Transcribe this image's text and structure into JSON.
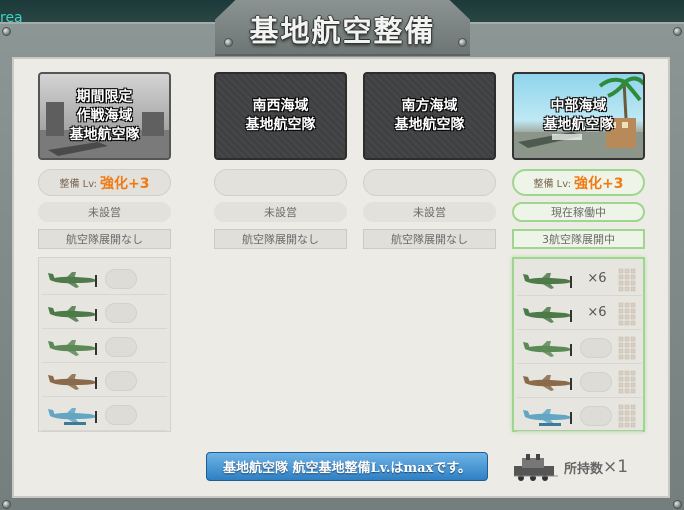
{
  "window": {
    "title": "基地航空整備",
    "corner_text": "rea"
  },
  "columns": [
    {
      "card_label": [
        "期間限定",
        "作戦海域",
        "基地航空隊"
      ],
      "card_style": "event",
      "level_label": "整備 Lv:",
      "level_value": "強化+3",
      "status": "未設営",
      "deploy": "航空隊展開なし",
      "slots": [
        {
          "plane": "fighter-plane-icon",
          "color": "#4f7a4a",
          "count": ""
        },
        {
          "plane": "attacker-plane-icon",
          "color": "#4c7a48",
          "count": ""
        },
        {
          "plane": "interceptor-plane-icon",
          "color": "#5c8a56",
          "count": ""
        },
        {
          "plane": "army-fighter-plane-icon",
          "color": "#8a6a4a",
          "count": ""
        },
        {
          "plane": "seaplane-icon",
          "color": "#62a6c4",
          "count": ""
        }
      ]
    },
    {
      "card_label": [
        "南西海域",
        "基地航空隊"
      ],
      "card_style": "locked",
      "status": "未設営",
      "deploy": "航空隊展開なし"
    },
    {
      "card_label": [
        "南方海域",
        "基地航空隊"
      ],
      "card_style": "locked",
      "status": "未設営",
      "deploy": "航空隊展開なし"
    },
    {
      "card_label": [
        "中部海域",
        "基地航空隊"
      ],
      "card_style": "active",
      "level_label": "整備 Lv:",
      "level_value": "強化+3",
      "status": "現在稼働中",
      "deploy": "3航空隊展開中",
      "slots": [
        {
          "plane": "fighter-plane-icon",
          "color": "#4f7a4a",
          "count": "×6"
        },
        {
          "plane": "attacker-plane-icon",
          "color": "#4c7a48",
          "count": "×6"
        },
        {
          "plane": "interceptor-plane-icon",
          "color": "#5c8a56",
          "count": ""
        },
        {
          "plane": "army-fighter-plane-icon",
          "color": "#8a6a4a",
          "count": ""
        },
        {
          "plane": "seaplane-icon",
          "color": "#62a6c4",
          "count": ""
        }
      ]
    }
  ],
  "footer": {
    "max_message": "基地航空隊 航空基地整備Lv.はmaxです。",
    "owned_label": "所持数",
    "owned_count": "×1",
    "owned_icon": "construction-vehicle-icon"
  },
  "colors": {
    "accent": "#f07b14",
    "active_border": "#9fd68f",
    "banner": "#2e7fc4"
  }
}
